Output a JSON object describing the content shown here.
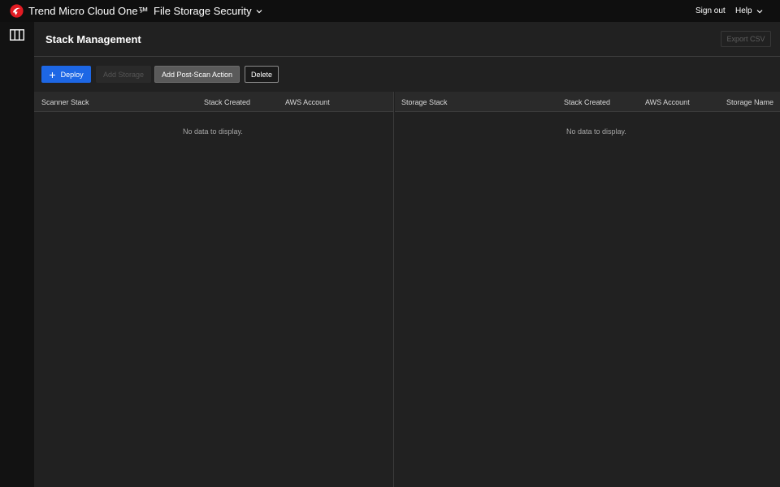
{
  "topbar": {
    "brand": "Trend Micro Cloud One™",
    "separator": "›",
    "product": "File Storage Security",
    "sign_out": "Sign out",
    "help": "Help",
    "brand_color": "#e21b23"
  },
  "page": {
    "title": "Stack Management",
    "export_label": "Export CSV"
  },
  "toolbar": {
    "deploy_icon": "+",
    "deploy_label": "Deploy",
    "add_storage_label": "Add Storage",
    "add_post_scan_label": "Add Post-Scan Action",
    "delete_label": "Delete",
    "accent_color": "#1d67e5"
  },
  "scanner_table": {
    "columns": [
      "Scanner Stack",
      "Stack Created",
      "AWS Account"
    ],
    "empty_text": "No data to display."
  },
  "storage_table": {
    "columns": [
      "Storage Stack",
      "Stack Created",
      "AWS Account",
      "Storage Name"
    ],
    "empty_text": "No data to display."
  }
}
